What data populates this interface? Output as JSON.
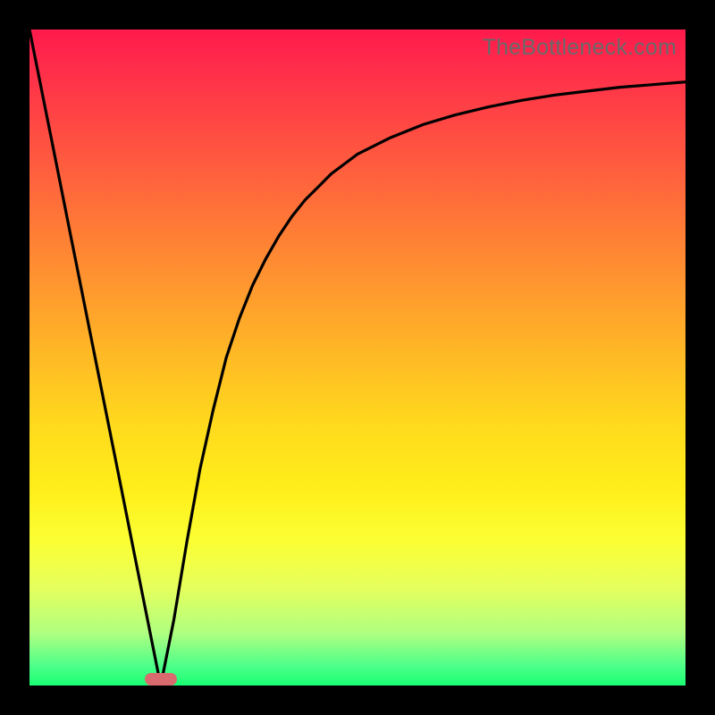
{
  "watermark": "TheBottleneck.com",
  "colors": {
    "frame": "#000000",
    "gradient_top": "#ff1a4d",
    "gradient_mid": "#ffd91d",
    "gradient_bottom": "#1aff73",
    "curve": "#000000",
    "marker": "#d96a6f",
    "watermark_text": "#6a6a6a"
  },
  "chart_data": {
    "type": "line",
    "title": "",
    "xlabel": "",
    "ylabel": "",
    "xlim": [
      0,
      100
    ],
    "ylim": [
      0,
      100
    ],
    "x": [
      0,
      2,
      4,
      6,
      8,
      10,
      12,
      14,
      16,
      18,
      20,
      22,
      24,
      26,
      28,
      30,
      32,
      34,
      36,
      38,
      40,
      42,
      44,
      46,
      48,
      50,
      55,
      60,
      65,
      70,
      75,
      80,
      85,
      90,
      95,
      100
    ],
    "y": [
      100,
      90,
      80,
      70,
      60,
      50,
      40,
      30,
      20,
      10,
      0,
      10,
      22,
      33,
      42,
      50,
      56,
      61,
      65,
      68.5,
      71.5,
      74,
      76,
      78,
      79.5,
      81,
      83.5,
      85.5,
      87,
      88.2,
      89.2,
      90,
      90.6,
      91.2,
      91.6,
      92
    ],
    "marker": {
      "x": 20,
      "y": 1
    },
    "notes": "V-shaped curve: linear descent from top-left to a minimum near x≈20, then asymptotic rise toward upper right. y=0 is bottom (green), y=100 is top (red)."
  }
}
